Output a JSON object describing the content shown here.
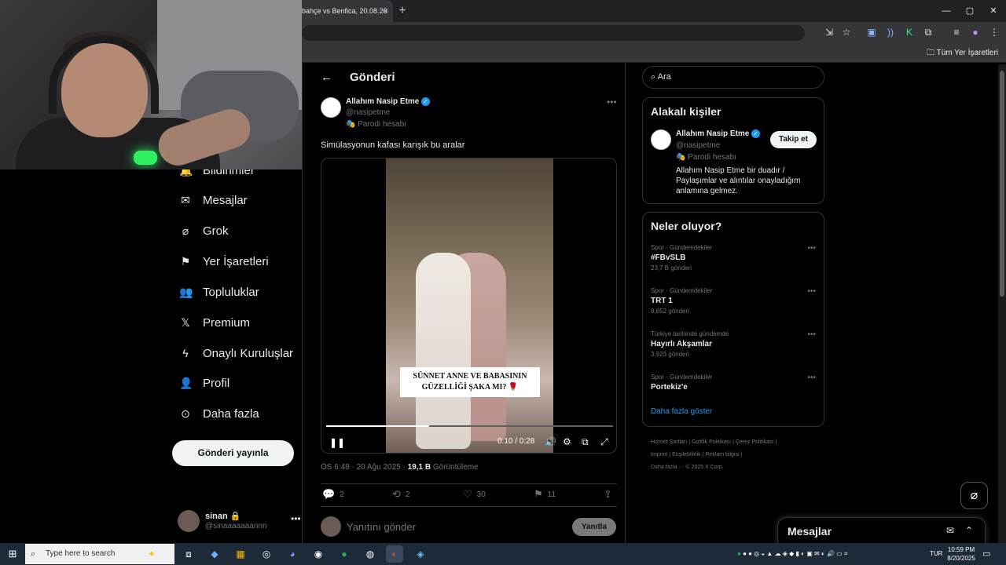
{
  "browser": {
    "tab_title": "bahçe vs Benfica, 20.08.20",
    "tab_close": "×",
    "new_tab": "+",
    "window_controls": [
      "—",
      "▢",
      "✕"
    ],
    "all_bookmarks": "Tüm Yer İşaretleri"
  },
  "nav": {
    "items": [
      {
        "icon": "bell-icon",
        "label": "Bildirimler"
      },
      {
        "icon": "mail-icon",
        "label": "Mesajlar"
      },
      {
        "icon": "grok-icon",
        "label": "Grok"
      },
      {
        "icon": "bookmark-icon",
        "label": "Yer İşaretleri"
      },
      {
        "icon": "communities-icon",
        "label": "Topluluklar"
      },
      {
        "icon": "x-logo-icon",
        "label": "Premium"
      },
      {
        "icon": "lightning-icon",
        "label": "Onaylı Kuruluşlar"
      },
      {
        "icon": "person-icon",
        "label": "Profil"
      },
      {
        "icon": "more-circle-icon",
        "label": "Daha fazla"
      }
    ],
    "post_button": "Gönderi yayınla",
    "account": {
      "name": "sinan 🔒",
      "handle": "@sinaaaaaaannn",
      "more": "•••"
    }
  },
  "post": {
    "back": "←",
    "header_title": "Gönderi",
    "author": "Allahım Nasip Etme",
    "handle": "@nasipetme",
    "parody_label": "🎭 Parodi hesabı",
    "more": "•••",
    "text": "Simülasyonun kafası karışık bu aralar",
    "video": {
      "caption_line1": "SÜNNET ANNE VE BABASININ",
      "caption_line2": "GÜZELLİĞİ ŞAKA MI? 🌹",
      "time": "0:10 / 0:28",
      "progress": 0.36
    },
    "meta_time": "ÖS 6:48 · 20 Ağu 2025 · ",
    "views_count": "19,1 B",
    "views_label": " Görüntüleme",
    "stats": {
      "replies": "2",
      "reposts": "2",
      "likes": "30",
      "bookmarks": "11"
    },
    "reply_placeholder": "Yanıtını gönder",
    "reply_button": "Yanıtla"
  },
  "sidebar": {
    "search_placeholder": "Ara",
    "relevant_title": "Alakalı kişiler",
    "relevant_person": {
      "name": "Allahım Nasip Etme",
      "handle": "@nasipetme",
      "parody": "🎭 Parodi hesabı",
      "bio": "Allahım Nasip Etme bir duadır / Paylaşımlar ve alıntılar onayladığım anlamına gelmez.",
      "follow": "Takip et"
    },
    "trends_title": "Neler oluyor?",
    "trends": [
      {
        "category": "Spor · Gündemdekiler",
        "name": "#FBvSLB",
        "count": "23,7 B gönderi"
      },
      {
        "category": "Spor · Gündemdekiler",
        "name": "TRT 1",
        "count": "8.652 gönderi"
      },
      {
        "category": "Türkiye tarihinde gündemde",
        "name": "Hayırlı Akşamlar",
        "count": "3.923 gönderi"
      },
      {
        "category": "Spor · Gündemdekiler",
        "name": "Portekiz'e",
        "count": ""
      }
    ],
    "show_more": "Daha fazla göster",
    "footer_line1": "Hizmet Şartları  |  Gizlilik Politikası  |  Çerez Politikası  |",
    "footer_line2": "Imprint  |  Erişilebilirlik  |  Reklam bilgisi  |",
    "footer_line3": "Daha fazla ···   © 2025 X Corp.",
    "messages_dock": "Mesajlar"
  },
  "taskbar": {
    "search_placeholder": "Type here to search",
    "language": "TUR",
    "time": "10:59 PM",
    "date": "8/20/2025"
  }
}
